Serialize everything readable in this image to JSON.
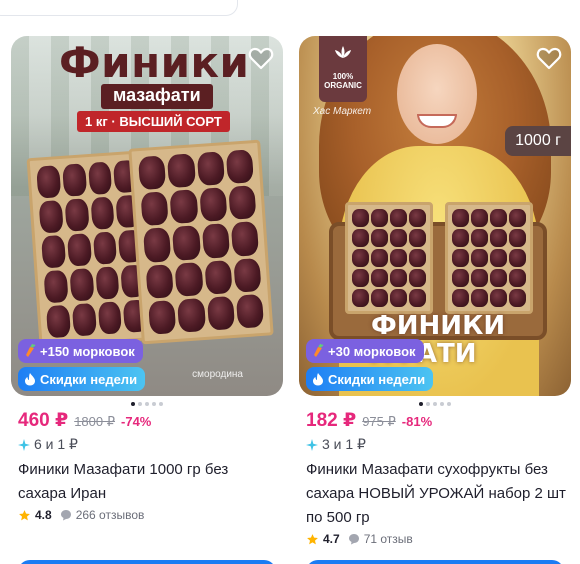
{
  "products": [
    {
      "image_text": {
        "title": "Финики",
        "subtitle": "мазафати",
        "tag": "1 кг · ВЫСШИЙ СОРТ",
        "watermark": "смородина"
      },
      "carrot_badge": "+150 морковок",
      "sale_badge": "Скидки недели",
      "price": "460 ₽",
      "old_price": "1800 ₽",
      "discount": "-74%",
      "installment": "6 и 1 ₽",
      "name": "Финики Мазафати 1000 гр без сахара Иран",
      "rating": "4.8",
      "reviews": "266 отзывов"
    },
    {
      "image_text": {
        "organic": "100% ORGANIC",
        "store": "Хас Маркет",
        "weight": "1000 г",
        "overlay": "ФИНИКИ\nАФАТИ"
      },
      "carrot_badge": "+30 морковок",
      "sale_badge": "Скидки недели",
      "price": "182 ₽",
      "old_price": "975 ₽",
      "discount": "-81%",
      "installment": "3 и 1 ₽",
      "name": "Финики Мазафати сухофрукты без сахара НОВЫЙ УРОЖАЙ набор 2 шт по 500 гр",
      "rating": "4.7",
      "reviews": "71 отзыв"
    }
  ],
  "colors": {
    "price": "#e6287c",
    "carrot_badge": "#7b61e0",
    "sale_badge": "#1e7ef4",
    "button": "#1b7cf3"
  },
  "icons": [
    "heart-icon",
    "carrot-icon",
    "fire-icon",
    "installment-icon",
    "star-icon",
    "comment-icon"
  ]
}
